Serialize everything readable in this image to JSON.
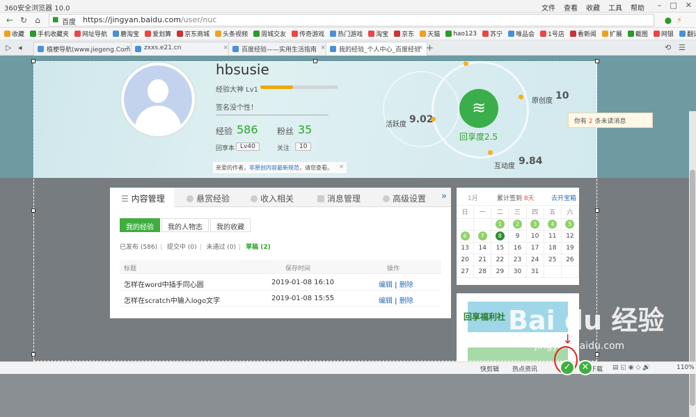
{
  "window": {
    "title": "360安全浏览器 10.0",
    "menu": [
      "文件",
      "查看",
      "收藏",
      "工具",
      "帮助"
    ]
  },
  "address": {
    "site_label": "百度",
    "url_host": "https://jingyan.baidu.com",
    "url_path": "/user/nuc"
  },
  "bookmarks": [
    "收藏",
    "手机收藏夹",
    "网址导航",
    "蘑淘宝",
    "爱划算",
    "京东商城",
    "头条视频",
    "周城交友",
    "传奇游戏",
    "热门游戏",
    "淘宝",
    "京东",
    "天猫",
    "hao123",
    "苏宁",
    "唯品会",
    "1号店",
    "看新闻",
    "扩展",
    "截图",
    "网银",
    "翻译",
    "冰球球去广"
  ],
  "tabs": [
    {
      "label": "植梗导航(www.jiegeng.Com)_欢",
      "active": false
    },
    {
      "label": "zxxs.e21.cn",
      "active": false
    },
    {
      "label": "百度经验——实用生活指南",
      "active": false
    },
    {
      "label": "我的经验_个人中心_百度经验",
      "active": true
    }
  ],
  "profile": {
    "username": "hbsusie",
    "level_label": "经验大神 Lv1",
    "level_progress": 0.42,
    "signature": "签名没个性！",
    "exp_label": "经验",
    "exp_value": "586",
    "fans_label": "粉丝",
    "fans_value": "35",
    "share_label": "回享本",
    "share_lv": "Lv40",
    "follow_label": "关注",
    "follow_value": "10",
    "notice_prefix": "亲爱的作者，",
    "notice_link": "非原创内容最新规范",
    "notice_suffix": "，请您查看。"
  },
  "metrics": {
    "center_label": "回享度2.5",
    "activity_label": "活跃度",
    "activity_value": "9.02",
    "original_label": "原创度",
    "original_value": "10",
    "interact_label": "互动度",
    "interact_value": "9.84"
  },
  "message_tip": {
    "prefix": "你有",
    "count": "2",
    "suffix": "条未读消息"
  },
  "content": {
    "tabs": [
      "内容管理",
      "悬赏经验",
      "收入相关",
      "消息管理",
      "高级设置"
    ],
    "more": "»",
    "subtabs": [
      "我的经验",
      "我的人物志",
      "我的收藏"
    ],
    "filters": [
      "已发布 (586)",
      "提交中 (0)",
      "未通过 (0)",
      "草稿 (2)"
    ],
    "columns": [
      "标题",
      "保存时间",
      "操作"
    ],
    "rows": [
      {
        "title": "怎样在word中插手同心圆",
        "time": "2019-01-08 16:10",
        "edit": "编辑",
        "sep": " | ",
        "del": "删除"
      },
      {
        "title": "怎样在scratch中输入logo文字",
        "time": "2019-01-08 15:55",
        "edit": "编辑",
        "sep": " | ",
        "del": "删除"
      }
    ]
  },
  "calendar": {
    "month": "1月",
    "streak_prefix": "累计签到",
    "streak_days": "8天",
    "treasure": "去开宝箱",
    "weekdays": [
      "日",
      "一",
      "二",
      "三",
      "四",
      "五",
      "六"
    ],
    "days": [
      "",
      "",
      "1",
      "2",
      "3",
      "4",
      "5",
      "6",
      "7",
      "8",
      "9",
      "10",
      "11",
      "12",
      "13",
      "14",
      "15",
      "16",
      "17",
      "18",
      "19",
      "20",
      "21",
      "22",
      "23",
      "24",
      "25",
      "26",
      "27",
      "28",
      "29",
      "30",
      "31",
      "",
      ""
    ],
    "checked": [
      "1",
      "2",
      "3",
      "4",
      "5",
      "6",
      "7"
    ],
    "today": "8"
  },
  "promo": {
    "title": "回享福利社"
  },
  "watermark": {
    "brand": "Bai du 经验",
    "url": "jingyan.baidu.com"
  },
  "status": {
    "items": [
      "快剪辑",
      "热点资讯",
      "下载"
    ],
    "zoom": "110%"
  }
}
